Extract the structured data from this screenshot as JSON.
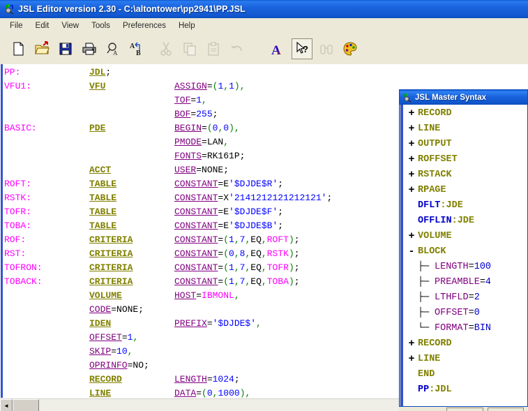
{
  "window": {
    "title": "JSL Editor version 2.30 - C:\\altontower\\pp2941\\PP.JSL",
    "icon": "jsl-app-icon"
  },
  "menu": {
    "items": [
      {
        "label": "File"
      },
      {
        "label": "Edit"
      },
      {
        "label": "View"
      },
      {
        "label": "Tools"
      },
      {
        "label": "Preferences"
      },
      {
        "label": "Help"
      }
    ]
  },
  "toolbar": {
    "buttons": [
      {
        "name": "new-file-icon",
        "enabled": true
      },
      {
        "name": "open-folder-icon",
        "enabled": true
      },
      {
        "name": "save-icon",
        "enabled": true
      },
      {
        "name": "print-icon",
        "enabled": true
      },
      {
        "name": "find-icon",
        "enabled": true
      },
      {
        "name": "replace-icon",
        "enabled": true
      },
      {
        "name": "cut-icon",
        "enabled": false
      },
      {
        "name": "copy-icon",
        "enabled": false
      },
      {
        "name": "paste-icon",
        "enabled": false
      },
      {
        "name": "undo-icon",
        "enabled": false
      },
      {
        "name": "font-icon",
        "enabled": true
      },
      {
        "name": "context-help-icon",
        "enabled": true,
        "selected": true
      },
      {
        "name": "binoculars-icon",
        "enabled": false
      },
      {
        "name": "palette-icon",
        "enabled": true
      }
    ]
  },
  "editor": {
    "lines": [
      {
        "label": "PP:",
        "keyword": "JDL",
        "keyword_suffix": ";",
        "attr": "",
        "rest": ""
      },
      {
        "label": "VFU1:",
        "keyword": "VFU",
        "keyword_suffix": "",
        "attr": "ASSIGN",
        "rest": "=(1,1),"
      },
      {
        "label": "",
        "keyword": "",
        "keyword_suffix": "",
        "attr": "TOF",
        "rest": "=1,"
      },
      {
        "label": "",
        "keyword": "",
        "keyword_suffix": "",
        "attr": "BOF",
        "rest": "=255;"
      },
      {
        "label": "BASIC:",
        "keyword": "PDE",
        "keyword_suffix": "",
        "attr": "BEGIN",
        "rest": "=(0,0),"
      },
      {
        "label": "",
        "keyword": "",
        "keyword_suffix": "",
        "attr": "PMODE",
        "rest": "=LAN,"
      },
      {
        "label": "",
        "keyword": "",
        "keyword_suffix": "",
        "attr": "FONTS",
        "rest": "=RK161P;"
      },
      {
        "label": "",
        "keyword": "ACCT",
        "keyword_suffix": "",
        "attr": "USER",
        "rest": "=NONE;"
      },
      {
        "label": "ROFT:",
        "keyword": "TABLE",
        "keyword_suffix": "",
        "attr": "CONSTANT",
        "rest": "=E'$DJDE$R';"
      },
      {
        "label": "RSTK:",
        "keyword": "TABLE",
        "keyword_suffix": "",
        "attr": "CONSTANT",
        "rest": "=X'2141212121212121';"
      },
      {
        "label": "TOFR:",
        "keyword": "TABLE",
        "keyword_suffix": "",
        "attr": "CONSTANT",
        "rest": "=E'$DJDE$F';"
      },
      {
        "label": "TOBA:",
        "keyword": "TABLE",
        "keyword_suffix": "",
        "attr": "CONSTANT",
        "rest": "=E'$DJDE$B';"
      },
      {
        "label": "ROF:",
        "keyword": "CRITERIA",
        "keyword_suffix": "",
        "attr": "CONSTANT",
        "rest": "=(1,7,EQ,ROFT);"
      },
      {
        "label": "RST:",
        "keyword": "CRITERIA",
        "keyword_suffix": "",
        "attr": "CONSTANT",
        "rest": "=(0,8,EQ,RSTK);"
      },
      {
        "label": "TOFRON:",
        "keyword": "CRITERIA",
        "keyword_suffix": "",
        "attr": "CONSTANT",
        "rest": "=(1,7,EQ,TOFR);"
      },
      {
        "label": "TOBACK:",
        "keyword": "CRITERIA",
        "keyword_suffix": "",
        "attr": "CONSTANT",
        "rest": "=(1,7,EQ,TOBA);"
      },
      {
        "label": "",
        "keyword": "VOLUME",
        "keyword_suffix": "",
        "attr": "HOST",
        "rest": "=IBMONL,"
      },
      {
        "label": "",
        "keyword": "",
        "keyword_suffix": "",
        "attr": "CODE",
        "rest": "=NONE;",
        "attr_col": 2
      },
      {
        "label": "",
        "keyword": "IDEN",
        "keyword_suffix": "",
        "attr": "PREFIX",
        "rest": "='$DJDE$',"
      },
      {
        "label": "",
        "keyword": "",
        "keyword_suffix": "",
        "attr": "OFFSET",
        "rest": "=1,",
        "attr_col": 2
      },
      {
        "label": "",
        "keyword": "",
        "keyword_suffix": "",
        "attr": "SKIP",
        "rest": "=10,",
        "attr_col": 2
      },
      {
        "label": "",
        "keyword": "",
        "keyword_suffix": "",
        "attr": "OPRINFO",
        "rest": "=NO;",
        "attr_col": 2
      },
      {
        "label": "",
        "keyword": "RECORD",
        "keyword_suffix": "",
        "attr": "LENGTH",
        "rest": "=1024;"
      },
      {
        "label": "",
        "keyword": "LINE",
        "keyword_suffix": "",
        "attr": "DATA",
        "rest": "=(0,1000),"
      }
    ]
  },
  "syntax_panel": {
    "title": "JSL Master Syntax",
    "icon": "jsl-app-icon",
    "nodes": [
      {
        "marker": "+",
        "text": "RECORD",
        "style": "keyword",
        "indent": 0
      },
      {
        "marker": "+",
        "text": "LINE",
        "style": "keyword",
        "indent": 0
      },
      {
        "marker": "+",
        "text": "OUTPUT",
        "style": "keyword",
        "indent": 0
      },
      {
        "marker": "+",
        "text": "ROFFSET",
        "style": "keyword",
        "indent": 0
      },
      {
        "marker": "+",
        "text": "RSTACK",
        "style": "keyword",
        "indent": 0
      },
      {
        "marker": "+",
        "text": "RPAGE",
        "style": "keyword",
        "indent": 0
      },
      {
        "marker": "",
        "text": "DFLT",
        "suffix": ":JDE",
        "style": "labelpair",
        "indent": 0
      },
      {
        "marker": "",
        "text": "OFFLIN",
        "suffix": ":JDE",
        "style": "labelpair",
        "indent": 0
      },
      {
        "marker": "+",
        "text": "VOLUME",
        "style": "keyword",
        "indent": 0
      },
      {
        "marker": "-",
        "text": "BLOCK",
        "style": "keyword",
        "indent": 0
      },
      {
        "marker": "tee",
        "text": "LENGTH=100",
        "style": "attr",
        "indent": 1
      },
      {
        "marker": "tee",
        "text": "PREAMBLE=4",
        "style": "attr",
        "indent": 1
      },
      {
        "marker": "tee",
        "text": "LTHFLD=2",
        "style": "attr",
        "indent": 1
      },
      {
        "marker": "tee",
        "text": "OFFSET=0",
        "style": "attr",
        "indent": 1
      },
      {
        "marker": "ell",
        "text": "FORMAT=BIN",
        "style": "attr",
        "indent": 1
      },
      {
        "marker": "+",
        "text": "RECORD",
        "style": "keyword",
        "indent": 0
      },
      {
        "marker": "+",
        "text": "LINE",
        "style": "keyword",
        "indent": 0
      },
      {
        "marker": "",
        "text": "END",
        "style": "keyword",
        "indent": 0
      },
      {
        "marker": "",
        "text": "PP",
        "suffix": ":JDL",
        "style": "labelpair",
        "indent": 0
      }
    ]
  },
  "scrollbar": {
    "left_arrow": "◄",
    "right_arrow": "►"
  },
  "colors": {
    "titlebar": "#1257cf",
    "label": "#ff00ff",
    "keyword": "#808000",
    "attribute": "#800080",
    "value": "#0000ff",
    "chrome": "#ece9d8"
  }
}
